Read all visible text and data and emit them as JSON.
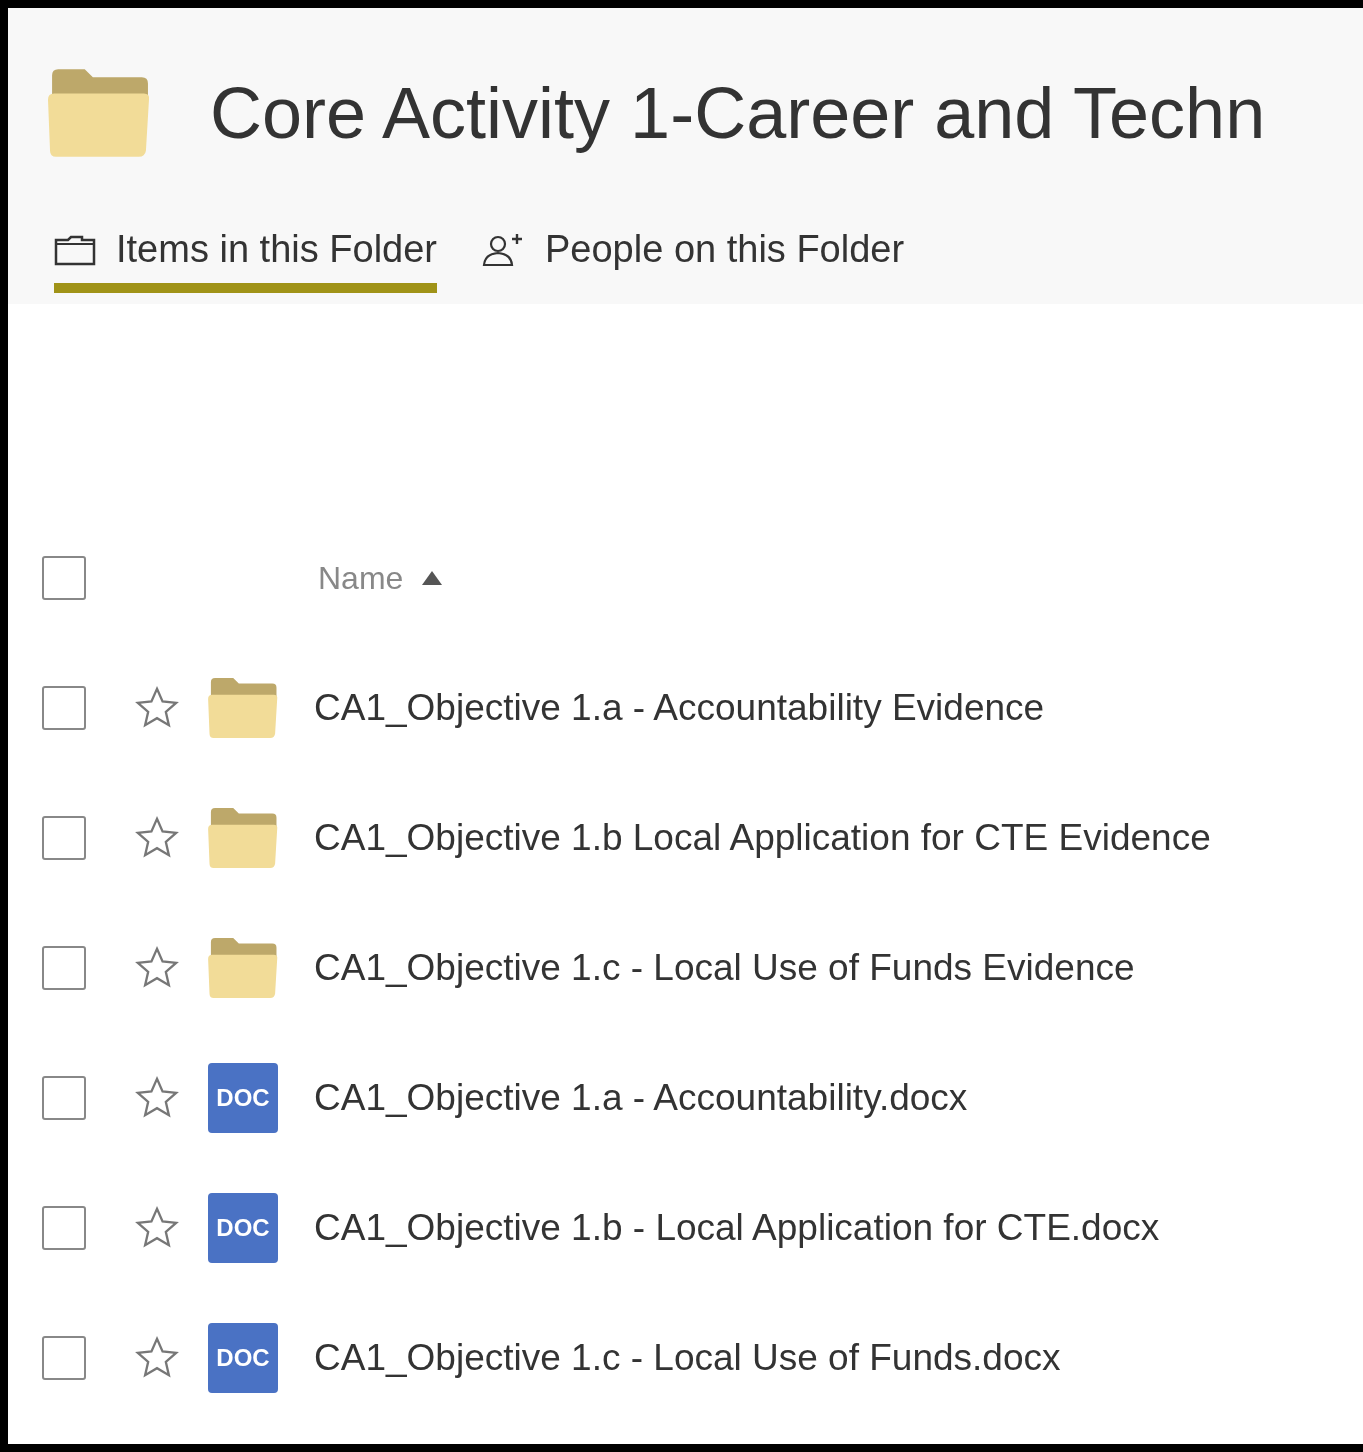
{
  "folder": {
    "title": "Core Activity 1-Career and Techn"
  },
  "tabs": [
    {
      "label": "Items in this Folder",
      "kind": "items",
      "selected": true
    },
    {
      "label": "People on this Folder",
      "kind": "people",
      "selected": false
    }
  ],
  "list": {
    "select_all_checked": false,
    "column": {
      "label": "Name",
      "sort_ascending": true
    },
    "rows": [
      {
        "kind": "folder",
        "name": "CA1_Objective 1.a - Accountability Evidence",
        "checked": false,
        "starred": false
      },
      {
        "kind": "folder",
        "name": "CA1_Objective 1.b Local Application for CTE Evidence",
        "checked": false,
        "starred": false
      },
      {
        "kind": "folder",
        "name": "CA1_Objective 1.c - Local Use of Funds Evidence",
        "checked": false,
        "starred": false
      },
      {
        "kind": "doc",
        "badge": "DOC",
        "name": "CA1_Objective 1.a - Accountability.docx",
        "checked": false,
        "starred": false
      },
      {
        "kind": "doc",
        "badge": "DOC",
        "name": "CA1_Objective 1.b - Local Application for CTE.docx",
        "checked": false,
        "starred": false
      },
      {
        "kind": "doc",
        "badge": "DOC",
        "name": "CA1_Objective 1.c - Local Use of Funds.docx",
        "checked": false,
        "starred": false
      }
    ]
  }
}
